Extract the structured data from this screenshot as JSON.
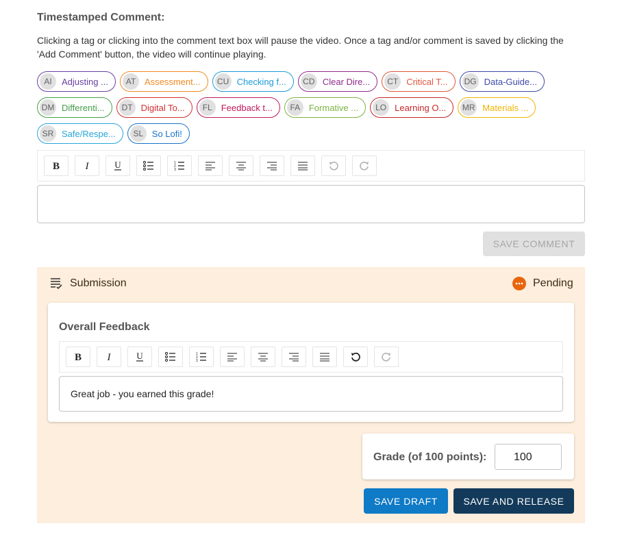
{
  "comment": {
    "heading": "Timestamped Comment:",
    "description": "Clicking a tag or clicking into the comment text box will pause the video. Once a tag and/or comment is saved by clicking the 'Add Comment' button, the video will continue playing.",
    "tags": [
      {
        "abbr": "AI",
        "label": "Adjusting ...",
        "color": "#6a3fa0"
      },
      {
        "abbr": "AT",
        "label": "Assessment...",
        "color": "#f08a24"
      },
      {
        "abbr": "CU",
        "label": "Checking f...",
        "color": "#1b9bd7"
      },
      {
        "abbr": "CD",
        "label": "Clear Dire...",
        "color": "#8e2a8b"
      },
      {
        "abbr": "CT",
        "label": "Critical T...",
        "color": "#e0553b"
      },
      {
        "abbr": "DG",
        "label": "Data-Guide...",
        "color": "#3f4aa8"
      },
      {
        "abbr": "DM",
        "label": "Differenti...",
        "color": "#43a047"
      },
      {
        "abbr": "DT",
        "label": "Digital To...",
        "color": "#d32f2f"
      },
      {
        "abbr": "FL",
        "label": "Feedback t...",
        "color": "#c2185b"
      },
      {
        "abbr": "FA",
        "label": "Formative ...",
        "color": "#7cb342"
      },
      {
        "abbr": "LO",
        "label": "Learning O...",
        "color": "#c62828"
      },
      {
        "abbr": "MR",
        "label": "Materials ...",
        "color": "#f0b400"
      },
      {
        "abbr": "SR",
        "label": "Safe/Respe...",
        "color": "#26a6d9"
      },
      {
        "abbr": "SL",
        "label": "So Lofi!",
        "color": "#1a73c9"
      }
    ],
    "text_value": "",
    "save_label": "SAVE COMMENT"
  },
  "submission": {
    "title": "Submission",
    "status": "Pending",
    "status_color": "#e8650c",
    "feedback_heading": "Overall Feedback",
    "feedback_text": "Great job - you earned this grade!",
    "grade_label": "Grade (of 100 points):",
    "grade_value": "100",
    "save_draft_label": "SAVE DRAFT",
    "save_release_label": "SAVE AND RELEASE"
  }
}
